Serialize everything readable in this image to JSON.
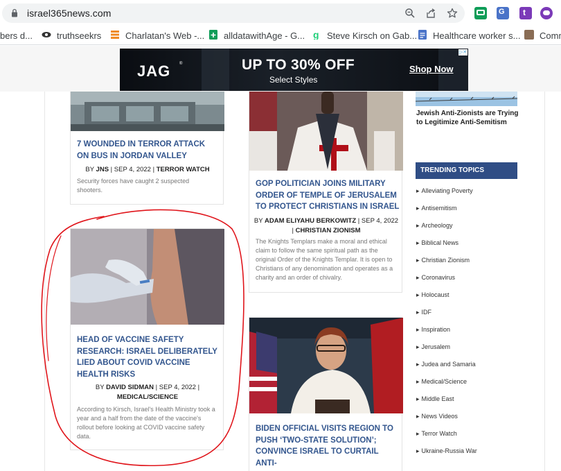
{
  "browser": {
    "url": "israel365news.com",
    "bookmarks": [
      {
        "label": "bers d..."
      },
      {
        "label": "truthseekrs"
      },
      {
        "label": "Charlatan's Web -..."
      },
      {
        "label": "alldatawithAge - G..."
      },
      {
        "label": "Steve Kirsch on Gab..."
      },
      {
        "label": "Healthcare worker s..."
      },
      {
        "label": "Comm"
      }
    ]
  },
  "ad": {
    "brand": "JAG",
    "headline": "UP TO 30% OFF",
    "subline": "Select Styles",
    "cta": "Shop Now"
  },
  "articles": [
    {
      "headline": "7 WOUNDED IN TERROR ATTACK ON BUS IN JORDAN VALLEY",
      "by": "BY",
      "author": "JNS",
      "date": "SEP 4, 2022",
      "category": "TERROR WATCH",
      "excerpt": "Security forces have caught 2 suspected shooters."
    },
    {
      "headline": "GOP POLITICIAN JOINS MILITARY ORDER OF TEMPLE OF JERUSALEM TO PROTECT CHRISTIANS IN ISRAEL",
      "by": "BY",
      "author": "ADAM ELIYAHU BERKOWITZ",
      "date": "SEP 4, 2022",
      "category": "CHRISTIAN ZIONISM",
      "excerpt": "The Knights Templars make a moral and ethical claim to follow the same spiritual path as the original Order of the Knights Templar. It is open to Christians of any denomination and operates as a charity and an order of chivalry."
    },
    {
      "headline": "HEAD OF VACCINE SAFETY RESEARCH: ISRAEL DELIBERATELY LIED ABOUT COVID VACCINE HEALTH RISKS",
      "by": "BY",
      "author": "DAVID SIDMAN",
      "date": "SEP 4, 2022",
      "category": "MEDICAL/SCIENCE",
      "excerpt": "According to Kirsch, Israel's Health Ministry took a year and a half from the date of the vaccine's rollout before looking at COVID vaccine safety data."
    },
    {
      "headline": "BIDEN OFFICIAL VISITS REGION TO PUSH ‘TWO-STATE SOLUTION’; CONVINCE ISRAEL TO CURTAIL ANTI-"
    }
  ],
  "sidebar": {
    "featured_headline": "Jewish Anti-Zionists are Trying to Legitimize Anti-Semitism",
    "trending_title": "TRENDING TOPICS",
    "topics": [
      "Alleviating Poverty",
      "Antisemitism",
      "Archeology",
      "Biblical News",
      "Christian Zionism",
      "Coronavirus",
      "Holocaust",
      "IDF",
      "Inspiration",
      "Jerusalem",
      "Judea and Samaria",
      "Medical/Science",
      "Middle East",
      "News Videos",
      "Terror Watch",
      "Ukraine-Russia War"
    ]
  },
  "colors": {
    "headline_blue": "#33568e",
    "trending_bg": "#2f4d85",
    "annotation_red": "#e0151b"
  }
}
